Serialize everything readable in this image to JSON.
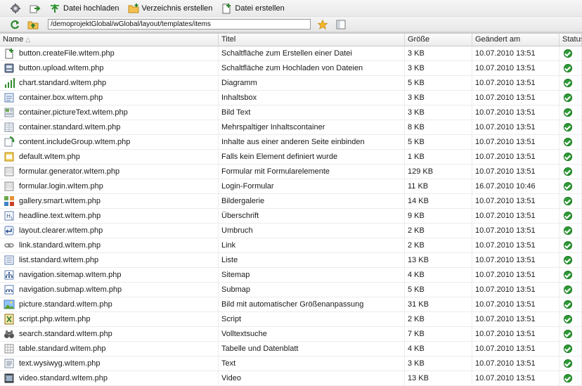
{
  "toolbar": {
    "upload_label": "Datei hochladen",
    "mkdir_label": "Verzeichnis erstellen",
    "newfile_label": "Datei erstellen"
  },
  "pathbar": {
    "path": "/demoprojektGlobal/wGlobal/layout/templates/items"
  },
  "columns": {
    "name": "Name",
    "title": "Titel",
    "size": "Größe",
    "modified": "Geändert am",
    "status": "Status"
  },
  "files": [
    {
      "icon": "create-file-icon",
      "name": "button.createFile.wItem.php",
      "title": "Schaltfläche zum Erstellen einer Datei",
      "size": "3 KB",
      "modified": "10.07.2010 13:51"
    },
    {
      "icon": "upload-icon",
      "name": "button.upload.wItem.php",
      "title": "Schaltfläche zum Hochladen von Dateien",
      "size": "3 KB",
      "modified": "10.07.2010 13:51"
    },
    {
      "icon": "chart-icon",
      "name": "chart.standard.wItem.php",
      "title": "Diagramm",
      "size": "5 KB",
      "modified": "10.07.2010 13:51"
    },
    {
      "icon": "box-icon",
      "name": "container.box.wItem.php",
      "title": "Inhaltsbox",
      "size": "3 KB",
      "modified": "10.07.2010 13:51"
    },
    {
      "icon": "picture-text-icon",
      "name": "container.pictureText.wItem.php",
      "title": "Bild Text",
      "size": "3 KB",
      "modified": "10.07.2010 13:51"
    },
    {
      "icon": "columns-icon",
      "name": "container.standard.wItem.php",
      "title": "Mehrspaltiger Inhaltscontainer",
      "size": "8 KB",
      "modified": "10.07.2010 13:51"
    },
    {
      "icon": "include-icon",
      "name": "content.includeGroup.wItem.php",
      "title": "Inhalte aus einer anderen Seite einbinden",
      "size": "5 KB",
      "modified": "10.07.2010 13:51"
    },
    {
      "icon": "default-icon",
      "name": "default.wItem.php",
      "title": "Falls kein Element definiert wurde",
      "size": "1 KB",
      "modified": "10.07.2010 13:51"
    },
    {
      "icon": "form-icon",
      "name": "formular.generator.wItem.php",
      "title": "Formular mit Formularelemente",
      "size": "129 KB",
      "modified": "10.07.2010 13:51"
    },
    {
      "icon": "form-icon",
      "name": "formular.login.wItem.php",
      "title": "Login-Formular",
      "size": "11 KB",
      "modified": "16.07.2010 10:46"
    },
    {
      "icon": "gallery-icon",
      "name": "gallery.smart.wItem.php",
      "title": "Bildergalerie",
      "size": "14 KB",
      "modified": "10.07.2010 13:51"
    },
    {
      "icon": "headline-icon",
      "name": "headline.text.wItem.php",
      "title": "Überschrift",
      "size": "9 KB",
      "modified": "10.07.2010 13:51"
    },
    {
      "icon": "return-icon",
      "name": "layout.clearer.wItem.php",
      "title": "Umbruch",
      "size": "2 KB",
      "modified": "10.07.2010 13:51"
    },
    {
      "icon": "link-icon",
      "name": "link.standard.wItem.php",
      "title": "Link",
      "size": "2 KB",
      "modified": "10.07.2010 13:51"
    },
    {
      "icon": "list-icon",
      "name": "list.standard.wItem.php",
      "title": "Liste",
      "size": "13 KB",
      "modified": "10.07.2010 13:51"
    },
    {
      "icon": "sitemap-icon",
      "name": "navigation.sitemap.wItem.php",
      "title": "Sitemap",
      "size": "4 KB",
      "modified": "10.07.2010 13:51"
    },
    {
      "icon": "submap-icon",
      "name": "navigation.submap.wItem.php",
      "title": "Submap",
      "size": "5 KB",
      "modified": "10.07.2010 13:51"
    },
    {
      "icon": "picture-icon",
      "name": "picture.standard.wItem.php",
      "title": "Bild mit automatischer Größenanpassung",
      "size": "31 KB",
      "modified": "10.07.2010 13:51"
    },
    {
      "icon": "script-icon",
      "name": "script.php.wItem.php",
      "title": "Script",
      "size": "2 KB",
      "modified": "10.07.2010 13:51"
    },
    {
      "icon": "binoculars-icon",
      "name": "search.standard.wItem.php",
      "title": "Volltextsuche",
      "size": "7 KB",
      "modified": "10.07.2010 13:51"
    },
    {
      "icon": "table-icon",
      "name": "table.standard.wItem.php",
      "title": "Tabelle und Datenblatt",
      "size": "4 KB",
      "modified": "10.07.2010 13:51"
    },
    {
      "icon": "text-icon",
      "name": "text.wysiwyg.wItem.php",
      "title": "Text",
      "size": "3 KB",
      "modified": "10.07.2010 13:51"
    },
    {
      "icon": "video-icon",
      "name": "video.standard.wItem.php",
      "title": "Video",
      "size": "13 KB",
      "modified": "10.07.2010 13:51"
    }
  ]
}
